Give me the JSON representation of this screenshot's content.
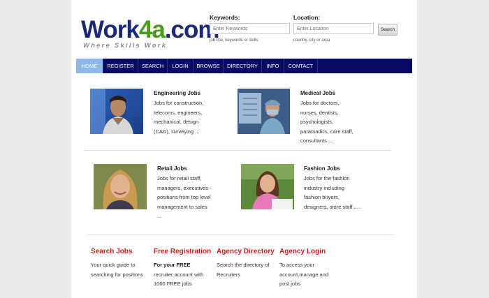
{
  "logo": {
    "part1": "Work",
    "part2": "4a",
    "part3": ".com",
    "tagline": "Where Skills Work",
    "colors": {
      "blue": "#1b2a78",
      "green": "#4a9a1c"
    }
  },
  "search": {
    "keywords_label": "Keywords:",
    "keywords_placeholder": "Enter Keywords",
    "keywords_help": "job title, keywords or skills",
    "location_label": "Location:",
    "location_placeholder": "Enter Location",
    "location_help": "country, city or area",
    "button": "Search"
  },
  "nav": {
    "items": [
      "HOME",
      "REGISTER",
      "SEARCH",
      "LOGIN",
      "BROWSE",
      "DIRECTORY",
      "INFO",
      "CONTACT"
    ],
    "active": "HOME",
    "bg_color": "#060a63",
    "active_color": "#8fb8e6"
  },
  "jobs": [
    {
      "title": "Engineering Jobs",
      "text": "Jobs for construction, telecoms, engineers, mechanical, design (CAD), surveying ..."
    },
    {
      "title": "Medical Jobs",
      "text": "Jobs for doctors, nurses, dentists, psychologists, paramadics, care staff, consultants ..."
    },
    {
      "title": "Retail Jobs",
      "text": "Jobs for retail staff, managers, executives - positions from top level management to sales ..."
    },
    {
      "title": "Fashion Jobs",
      "text": "Jobs for the fashion industry including fashion buyers, designers, store staff ....."
    }
  ],
  "bottom": {
    "search_jobs": {
      "title": "Search Jobs",
      "text": "Your quick guide to searching for positions"
    },
    "free_registration": {
      "title": "Free Registration",
      "bold": "For your FREE",
      "text": " recruiter account with 1000 FREE jobs"
    },
    "agency_directory": {
      "title": "Agency Directory",
      "text": "Search the directory of Recruiters"
    },
    "agency_login": {
      "title": "Agency Login",
      "text": "To access your account,manage and post jobs"
    },
    "title_color": "#d41f1f"
  }
}
